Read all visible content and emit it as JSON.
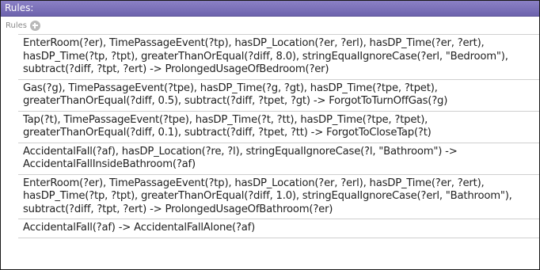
{
  "panel": {
    "title": "Rules:",
    "list_label": "Rules"
  },
  "rules": [
    {
      "lines": [
        "EnterRoom(?er), TimePassageEvent(?tp), hasDP_Location(?er, ?erl), hasDP_Time(?er, ?ert),",
        "hasDP_Time(?tp, ?tpt), greaterThanOrEqual(?diff, 8.0), stringEqualIgnoreCase(?erl, \"Bedroom\"),",
        "subtract(?diff, ?tpt, ?ert) -> ProlongedUsageOfBedroom(?er)"
      ]
    },
    {
      "lines": [
        "Gas(?g), TimePassageEvent(?tpe), hasDP_Time(?g, ?gt), hasDP_Time(?tpe, ?tpet),",
        "greaterThanOrEqual(?diff, 0.5), subtract(?diff, ?tpet, ?gt) -> ForgotToTurnOffGas(?g)"
      ]
    },
    {
      "lines": [
        "Tap(?t), TimePassageEvent(?tpe), hasDP_Time(?t, ?tt), hasDP_Time(?tpe, ?tpet),",
        "greaterThanOrEqual(?diff, 0.1), subtract(?diff, ?tpet, ?tt) -> ForgotToCloseTap(?t)"
      ]
    },
    {
      "lines": [
        "AccidentalFall(?af), hasDP_Location(?re, ?l), stringEqualIgnoreCase(?l, \"Bathroom\") ->",
        "AccidentalFallInsideBathroom(?af)"
      ]
    },
    {
      "lines": [
        "EnterRoom(?er), TimePassageEvent(?tp), hasDP_Location(?er, ?erl), hasDP_Time(?er, ?ert),",
        "hasDP_Time(?tp, ?tpt), greaterThanOrEqual(?diff, 1.0), stringEqualIgnoreCase(?erl, \"Bathroom\"),",
        "subtract(?diff, ?tpt, ?ert) -> ProlongedUsageOfBathroom(?er)"
      ]
    },
    {
      "lines": [
        "AccidentalFall(?af) -> AccidentalFallAlone(?af)"
      ]
    }
  ],
  "icons": {
    "add_rule": "plus-circle-icon"
  },
  "colors": {
    "header_bg": "#7a70b8",
    "header_text": "#ffffff",
    "add_icon": "#b9b9b9",
    "row_border": "#cfcfcf"
  }
}
